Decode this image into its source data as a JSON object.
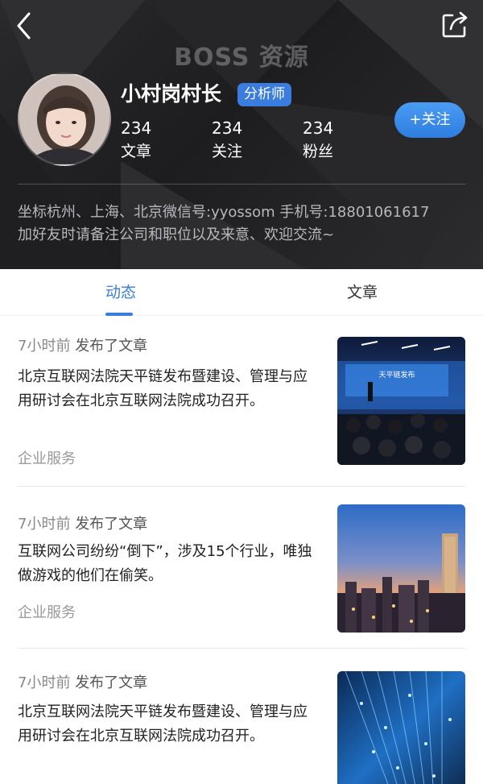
{
  "header": {
    "watermark": "BOSS 资源",
    "username": "小村岗村长",
    "role_badge": "分析师",
    "stats": [
      {
        "value": "234",
        "label": "文章"
      },
      {
        "value": "234",
        "label": "关注"
      },
      {
        "value": "234",
        "label": "粉丝"
      }
    ],
    "follow_label": "+关注",
    "bio_line1": "坐标杭州、上海、北京微信号:yyossom 手机号:18801061617",
    "bio_line2": "加好友时请备注公司和职位以及来意、欢迎交流~"
  },
  "tabs": [
    {
      "label": "动态",
      "active": true
    },
    {
      "label": "文章",
      "active": false
    }
  ],
  "feed": [
    {
      "time": "7小时前",
      "action": "发布了文章",
      "title": "北京互联网法院天平链发布暨建设、管理与应用研讨会在北京互联网法院成功召开。",
      "tag": "企业服务",
      "image": "conference-photo",
      "image_text": "天平链发布"
    },
    {
      "time": "7小时前",
      "action": "发布了文章",
      "title": "互联网公司纷纷“倒下”，涉及15个行业，唯独做游戏的他们在偷笑。",
      "tag": "企业服务",
      "image": "city-skyline-photo"
    },
    {
      "time": "7小时前",
      "action": "发布了文章",
      "title": "北京互联网法院天平链发布暨建设、管理与应用研讨会在北京互联网法院成功召开。",
      "tag": "",
      "image": "fiber-optic-photo"
    }
  ],
  "colors": {
    "accent": "#3a7ddc",
    "header_bg": "#232325",
    "follow_button": "#2e7de0"
  }
}
